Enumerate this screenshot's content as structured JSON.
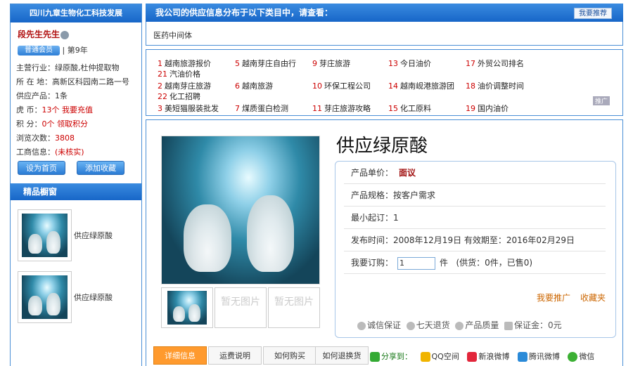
{
  "left": {
    "company_title": "四川九章生物化工科技发展",
    "contact_name": "段先生先生",
    "member_badge": "普通会员",
    "member_years": "第9年",
    "info": [
      {
        "key": "主营行业：",
        "value": "绿原酸,杜仲提取物"
      },
      {
        "key": "所 在 地：",
        "value": "高新区科园南二路一号"
      },
      {
        "key": "供应产品：",
        "value": "1条"
      },
      {
        "key": "虎     币：",
        "value": "13个",
        "link": "我要充值"
      },
      {
        "key": "积     分：",
        "value": "0个",
        "link": "领取积分"
      },
      {
        "key": "浏览次数：",
        "value": "3808"
      },
      {
        "key": "工商信息：",
        "value": "(未核实)"
      }
    ],
    "btn_homepage": "设为首页",
    "btn_favorite": "添加收藏",
    "showcase_title": "精品橱窗",
    "showcase": [
      {
        "label": "供应绿原酸"
      },
      {
        "label": "供应绿原酸"
      }
    ]
  },
  "top": {
    "banner": "我公司的供应信息分布于以下类目中，请查看：",
    "recommend_btn": "我要推荐",
    "category": "医药中间体"
  },
  "links": [
    {
      "num": "1",
      "text": "越南旅游报价"
    },
    {
      "num": "5",
      "text": "越南芽庄自由行"
    },
    {
      "num": "9",
      "text": "芽庄旅游"
    },
    {
      "num": "13",
      "text": "今日油价"
    },
    {
      "num": "17",
      "text": "外贸公司排名"
    },
    {
      "num": "21",
      "text": "汽油价格"
    },
    {
      "num": "2",
      "text": "越南芽庄旅游"
    },
    {
      "num": "6",
      "text": "越南旅游"
    },
    {
      "num": "10",
      "text": "环保工程公司"
    },
    {
      "num": "14",
      "text": "越南岘港旅游团"
    },
    {
      "num": "18",
      "text": "油价调整时间"
    },
    {
      "num": "22",
      "text": "化工招聘"
    },
    {
      "num": "3",
      "text": "美短猫服装批发"
    },
    {
      "num": "7",
      "text": "煤质蛋白检测"
    },
    {
      "num": "11",
      "text": "芽庄旅游攻略"
    },
    {
      "num": "15",
      "text": "化工原料"
    },
    {
      "num": "19",
      "text": "国内油价"
    }
  ],
  "ad_tag": "推广",
  "product": {
    "title": "供应绿原酸",
    "no_image": "暂无图片",
    "price_label": "产品单价：",
    "price_value": "面议",
    "spec_label": "产品规格：",
    "spec_value": "按客户需求",
    "min_label": "最小起订：",
    "min_value": "1",
    "date_text": "发布时间：2008年12月19日  有效期至：2016年02月29日",
    "order_label": "我要订购：",
    "order_value": "1",
    "order_unit": "件",
    "order_stock": "(供货：0件，已售0)",
    "act_promote": "我要推广",
    "act_collect": "收藏夹",
    "guarantees": [
      "诚信保证",
      "七天退货",
      "产品质量",
      "保证金：0元"
    ]
  },
  "tabs": [
    "详细信息",
    "运费说明",
    "如何购买",
    "如何退换货"
  ],
  "share": {
    "label": "分享到：",
    "items": [
      "QQ空间",
      "新浪微博",
      "腾讯微博",
      "微信"
    ]
  }
}
